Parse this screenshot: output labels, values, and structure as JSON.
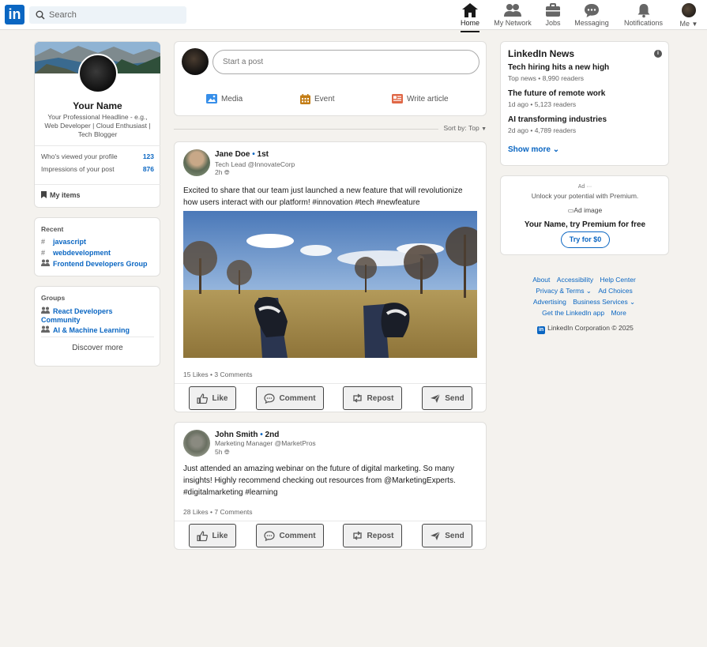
{
  "nav": {
    "logo_text": "in",
    "search_placeholder": "Search",
    "items": [
      {
        "label": "Home",
        "icon": "home-icon",
        "active": true
      },
      {
        "label": "My Network",
        "icon": "network-icon"
      },
      {
        "label": "Jobs",
        "icon": "briefcase-icon"
      },
      {
        "label": "Messaging",
        "icon": "messaging-icon"
      },
      {
        "label": "Notifications",
        "icon": "bell-icon"
      },
      {
        "label": "Me",
        "icon": "avatar"
      }
    ]
  },
  "profile": {
    "name": "Your Name",
    "headline": "Your Professional Headline - e.g., Web Developer | Cloud Enthusiast | Tech Blogger",
    "stats": [
      {
        "label": "Who's viewed your profile",
        "value": "123"
      },
      {
        "label": "Impressions of your post",
        "value": "876"
      }
    ],
    "my_items": "My items"
  },
  "recent": {
    "title": "Recent",
    "items": [
      {
        "prefix": "#",
        "label": "javascript"
      },
      {
        "prefix": "#",
        "label": "webdevelopment"
      },
      {
        "prefix": "group",
        "label": "Frontend Developers Group"
      }
    ]
  },
  "groups": {
    "title": "Groups",
    "items": [
      {
        "label": "React Developers Community"
      },
      {
        "label": "AI & Machine Learning"
      }
    ],
    "discover": "Discover more"
  },
  "composer": {
    "placeholder": "Start a post",
    "actions": [
      {
        "label": "Media",
        "icon": "image-icon",
        "color": "#378fe9"
      },
      {
        "label": "Event",
        "icon": "calendar-icon",
        "color": "#c37d16"
      },
      {
        "label": "Write article",
        "icon": "article-icon",
        "color": "#e06847"
      }
    ]
  },
  "sort": {
    "label": "Sort by:",
    "value": "Top"
  },
  "posts": [
    {
      "author": "Jane Doe",
      "degree": "1st",
      "title": "Tech Lead @InnovateCorp",
      "time": "2h",
      "text": "Excited to share that our team just launched a new feature that will revolutionize how users interact with our platform! #innovation #tech #newfeature",
      "counts": "15 Likes • 3 Comments",
      "has_image": true
    },
    {
      "author": "John Smith",
      "degree": "2nd",
      "title": "Marketing Manager @MarketPros",
      "time": "5h",
      "text": "Just attended an amazing webinar on the future of digital marketing. So many insights! Highly recommend checking out resources from @MarketingExperts. #digitalmarketing #learning",
      "counts": "28 Likes • 7 Comments",
      "has_image": false
    }
  ],
  "post_actions": [
    "Like",
    "Comment",
    "Repost",
    "Send"
  ],
  "news": {
    "title": "LinkedIn News",
    "items": [
      {
        "headline": "Tech hiring hits a new high",
        "meta": "Top news • 8,990 readers"
      },
      {
        "headline": "The future of remote work",
        "meta": "1d ago • 5,123 readers"
      },
      {
        "headline": "AI transforming industries",
        "meta": "2d ago • 4,789 readers"
      }
    ],
    "show_more": "Show more"
  },
  "ad": {
    "tag": "Ad ···",
    "line1": "Unlock your potential with Premium.",
    "image_alt": "Ad image",
    "main": "Your Name, try Premium for free",
    "button": "Try for $0"
  },
  "footer": {
    "row1": [
      "About",
      "Accessibility",
      "Help Center"
    ],
    "row2": [
      "Privacy & Terms ⌄",
      "Ad Choices"
    ],
    "row3": [
      "Advertising",
      "Business Services ⌄"
    ],
    "row4": [
      "Get the LinkedIn app",
      "More"
    ],
    "copyright": "LinkedIn Corporation © 2025"
  }
}
